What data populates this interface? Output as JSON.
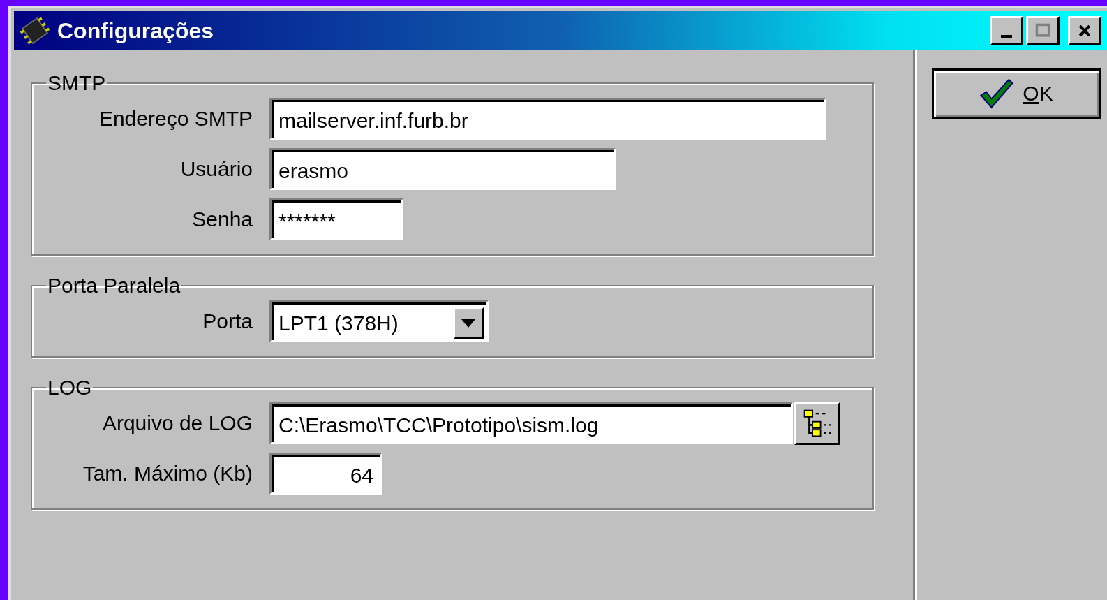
{
  "window": {
    "title": "Configurações"
  },
  "groups": [
    {
      "title": "SMTP",
      "rows": [
        {
          "kind": "text",
          "label": "Endereço SMTP",
          "value": "mailserver.inf.furb.br"
        },
        {
          "kind": "text",
          "label": "Usuário",
          "value": "erasmo"
        },
        {
          "kind": "text",
          "label": "Senha",
          "value": "*******"
        }
      ]
    },
    {
      "title": "Porta Paralela",
      "rows": [
        {
          "kind": "combo",
          "label": "Porta",
          "value": "LPT1 (378H)"
        }
      ]
    },
    {
      "title": "LOG",
      "rows": [
        {
          "kind": "browse",
          "label": "Arquivo de LOG",
          "value": "C:\\Erasmo\\TCC\\Prototipo\\sism.log"
        },
        {
          "kind": "number",
          "label": "Tam. Máximo (Kb)",
          "value": "64"
        }
      ]
    }
  ],
  "buttons": [
    {
      "label": "OK"
    }
  ]
}
